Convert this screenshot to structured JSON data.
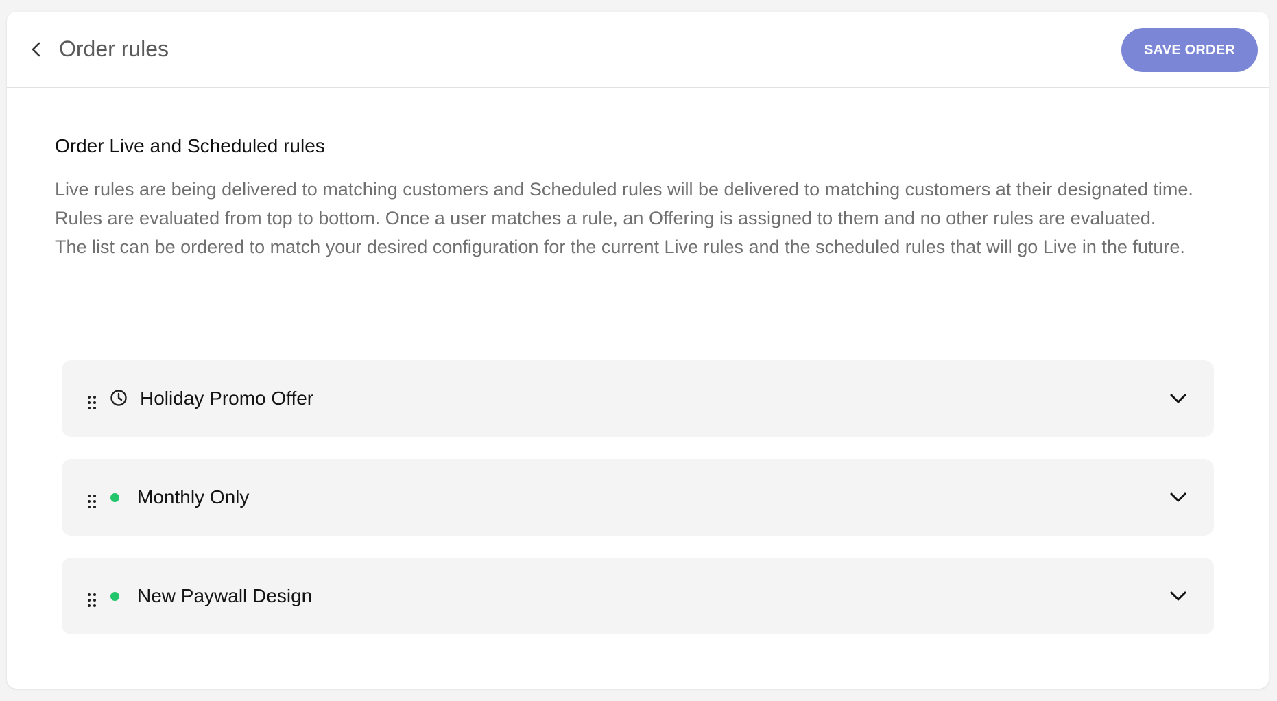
{
  "header": {
    "title": "Order rules",
    "save_label": "SAVE ORDER",
    "back_icon": "chevron-left-icon"
  },
  "section": {
    "title": "Order Live and Scheduled rules",
    "description_1": "Live rules are being delivered to matching customers and Scheduled rules will be delivered to matching customers at their designated time. Rules are evaluated from top to bottom. Once a user matches a rule, an Offering is assigned to them and no other rules are evaluated.",
    "description_2": "The list can be ordered to match your desired configuration for the current Live rules and the scheduled rules that will go Live in the future."
  },
  "rules": [
    {
      "name": "Holiday Promo Offer",
      "status": "scheduled",
      "status_icon": "clock-icon"
    },
    {
      "name": "Monthly Only",
      "status": "live",
      "status_icon": "live-status-dot"
    },
    {
      "name": "New Paywall Design",
      "status": "live",
      "status_icon": "live-status-dot"
    }
  ],
  "colors": {
    "accent": "#7b86d6",
    "live": "#22c56a",
    "row_background": "#f4f4f4",
    "muted_text": "#707070"
  }
}
